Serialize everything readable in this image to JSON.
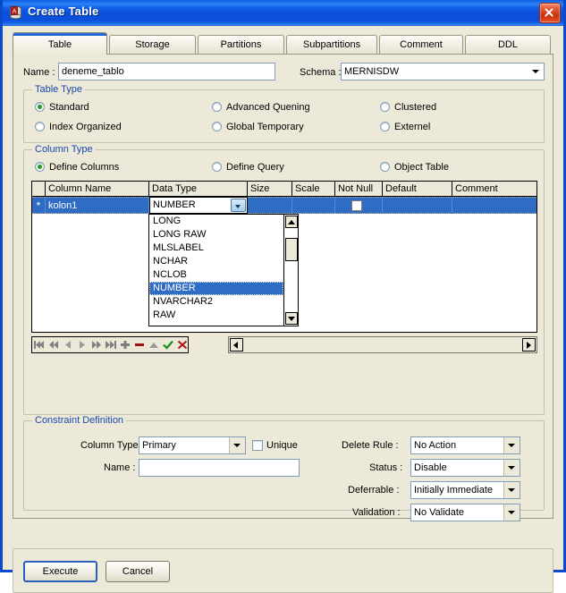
{
  "window": {
    "title": "Create Table",
    "icon": "database-table-icon",
    "close_label": "Close"
  },
  "tabs": [
    {
      "label": "Table",
      "active": true
    },
    {
      "label": "Storage",
      "active": false
    },
    {
      "label": "Partitions",
      "active": false
    },
    {
      "label": "Subpartitions",
      "active": false
    },
    {
      "label": "Comment",
      "active": false
    },
    {
      "label": "DDL",
      "active": false
    }
  ],
  "table_tab": {
    "name_label": "Name :",
    "name_value": "deneme_tablo",
    "schema_label": "Schema :",
    "schema_value": "MERNISDW",
    "table_type": {
      "title": "Table Type",
      "options": [
        {
          "label": "Standard",
          "selected": true
        },
        {
          "label": "Index Organized",
          "selected": false
        },
        {
          "label": "Advanced Quening",
          "selected": false
        },
        {
          "label": "Global Temporary",
          "selected": false
        },
        {
          "label": "Clustered",
          "selected": false
        },
        {
          "label": "Externel",
          "selected": false
        }
      ]
    },
    "column_type": {
      "title": "Column Type",
      "options": [
        {
          "label": "Define Columns",
          "selected": true
        },
        {
          "label": "Define Query",
          "selected": false
        },
        {
          "label": "Object Table",
          "selected": false
        }
      ]
    },
    "grid": {
      "headers": [
        "Column Name",
        "Data Type",
        "Size",
        "Scale",
        "Not Null",
        "Default",
        "Comment"
      ],
      "rows": [
        {
          "marker": "*",
          "column_name": "kolon1",
          "data_type": "NUMBER",
          "size": "",
          "scale": "",
          "not_null": false,
          "default": "",
          "comment": ""
        }
      ]
    },
    "datatype_dropdown": {
      "items": [
        {
          "label": "LONG",
          "selected": false
        },
        {
          "label": "LONG RAW",
          "selected": false
        },
        {
          "label": "MLSLABEL",
          "selected": false
        },
        {
          "label": "NCHAR",
          "selected": false
        },
        {
          "label": "NCLOB",
          "selected": false
        },
        {
          "label": "NUMBER",
          "selected": true
        },
        {
          "label": "NVARCHAR2",
          "selected": false
        },
        {
          "label": "RAW",
          "selected": false
        }
      ]
    },
    "navigator": [
      {
        "name": "first-record-button",
        "icon": "first-icon"
      },
      {
        "name": "prior-page-button",
        "icon": "prev-page-icon"
      },
      {
        "name": "prior-record-button",
        "icon": "prev-icon"
      },
      {
        "name": "next-record-button",
        "icon": "next-icon"
      },
      {
        "name": "next-page-button",
        "icon": "next-page-icon"
      },
      {
        "name": "last-record-button",
        "icon": "last-icon"
      },
      {
        "name": "insert-record-button",
        "icon": "plus-icon"
      },
      {
        "name": "delete-record-button",
        "icon": "minus-icon"
      },
      {
        "name": "edit-record-button",
        "icon": "triangle-up-icon"
      },
      {
        "name": "post-edit-button",
        "icon": "checkmark-icon"
      },
      {
        "name": "cancel-edit-button",
        "icon": "cross-icon"
      }
    ],
    "constraint": {
      "title": "Constraint Definition",
      "column_type_label": "Column Type :",
      "column_type_value": "Primary",
      "unique_label": "Unique",
      "unique_checked": false,
      "name_label": "Name :",
      "name_value": "",
      "delete_rule_label": "Delete Rule :",
      "delete_rule_value": "No Action",
      "status_label": "Status :",
      "status_value": "Disable",
      "deferrable_label": "Deferrable :",
      "deferrable_value": "Initially Immediate",
      "validation_label": "Validation :",
      "validation_value": "No Validate"
    }
  },
  "footer": {
    "execute_label": "Execute",
    "cancel_label": "Cancel"
  },
  "colors": {
    "titlebar_blue": "#0a50dc",
    "window_border": "#0a48cc",
    "face": "#ece9d8",
    "group_title": "#1a49b0",
    "selection": "#2f6cc4",
    "radio_dot_green": "#1e9e1e",
    "post_green": "#1a8a1a",
    "cancel_red": "#b01818",
    "delete_red": "#a01010"
  }
}
